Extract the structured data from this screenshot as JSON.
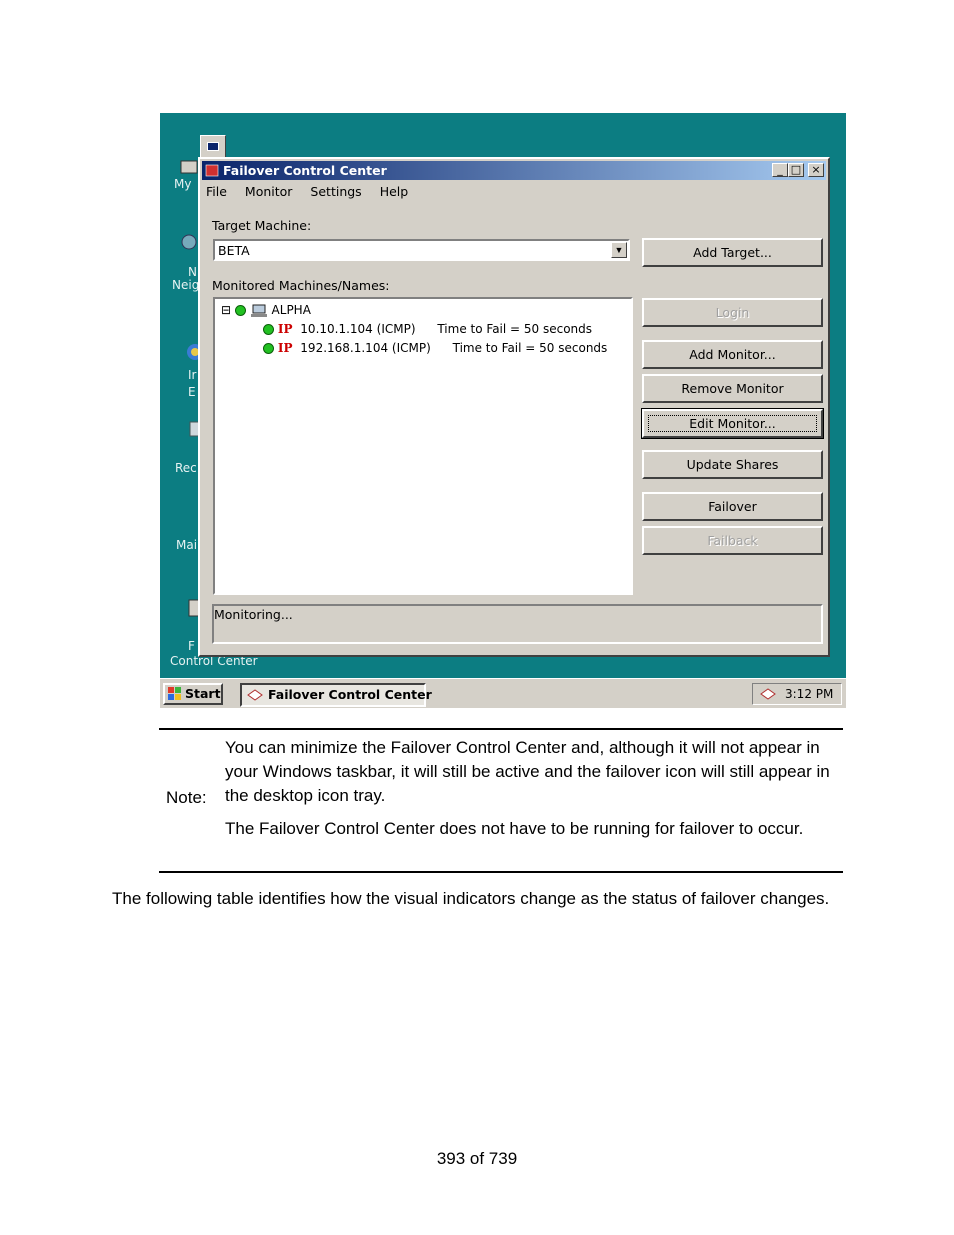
{
  "screenshot": {
    "desktop_labels": [
      "My",
      "N",
      "Neig",
      "Ir",
      "E",
      "Rec",
      "Mai",
      "F",
      "Control Center"
    ],
    "window": {
      "title": "Failover Control Center",
      "buttons": {
        "minimize": "_",
        "maximize": "□",
        "close": "×"
      },
      "menu": [
        "File",
        "Monitor",
        "Settings",
        "Help"
      ],
      "target_machine_label": "Target Machine:",
      "target_machine_value": "BETA",
      "monitored_label": "Monitored Machines/Names:",
      "tree": {
        "expander": "⊟",
        "machine": "ALPHA",
        "monitors": [
          {
            "ip_badge": "IP",
            "address": "10.10.1.104  (ICMP)",
            "time": "Time to Fail = 50 seconds"
          },
          {
            "ip_badge": "IP",
            "address": "192.168.1.104  (ICMP)",
            "time": "Time to Fail = 50 seconds"
          }
        ]
      },
      "action_buttons": {
        "add_target": "Add Target...",
        "login": "Login",
        "add_monitor": "Add Monitor...",
        "remove_monitor": "Remove Monitor",
        "edit_monitor": "Edit Monitor...",
        "update_shares": "Update Shares",
        "failover": "Failover",
        "failback": "Failback"
      },
      "status": "Monitoring..."
    },
    "taskbar": {
      "start": "Start",
      "task": "Failover Control Center",
      "clock": "3:12 PM"
    },
    "colors": {
      "desktop": "#0c7d82",
      "titlebar": "#0a246a",
      "status_ok": "#22c022"
    }
  },
  "note": {
    "label": "Note:",
    "paragraphs": [
      "You can minimize the Failover Control Center and, although it will not appear in your Windows taskbar, it will still be active and the failover icon will still appear in the desktop icon tray.",
      "The Failover Control Center does not have to be running for failover to occur."
    ]
  },
  "intro": "The following table identifies how the visual indicators change as the status of failover changes.",
  "footer": "393 of 739"
}
